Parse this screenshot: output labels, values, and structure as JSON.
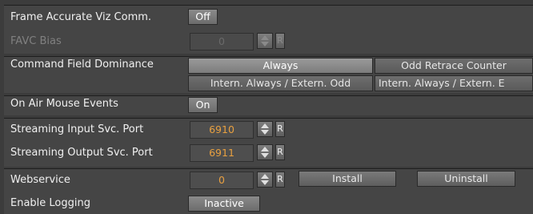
{
  "rows": {
    "frame_accurate": {
      "label": "Frame Accurate Viz Comm.",
      "toggle": "Off"
    },
    "favc_bias": {
      "label": "FAVC Bias",
      "value": "0",
      "reset": "R"
    },
    "command_field": {
      "label": "Command Field Dominance",
      "options_row1": [
        "Always",
        "Odd Retrace Counter"
      ],
      "options_row2": [
        "Intern. Always / Extern. Odd",
        "Intern. Always / Extern. E"
      ],
      "selected": "Always"
    },
    "on_air_mouse": {
      "label": "On Air Mouse Events",
      "toggle": "On"
    },
    "streaming_input": {
      "label": "Streaming Input Svc. Port",
      "value": "6910",
      "reset": "R"
    },
    "streaming_output": {
      "label": "Streaming Output Svc. Port",
      "value": "6911",
      "reset": "R"
    },
    "webservice": {
      "label": "Webservice",
      "value": "0",
      "reset": "R",
      "install": "Install",
      "uninstall": "Uninstall"
    },
    "logging": {
      "label": "Enable Logging",
      "toggle": "Inactive"
    }
  },
  "colors": {
    "value_text": "#e8a040",
    "panel": "#454545",
    "background": "#3a3a3a"
  }
}
